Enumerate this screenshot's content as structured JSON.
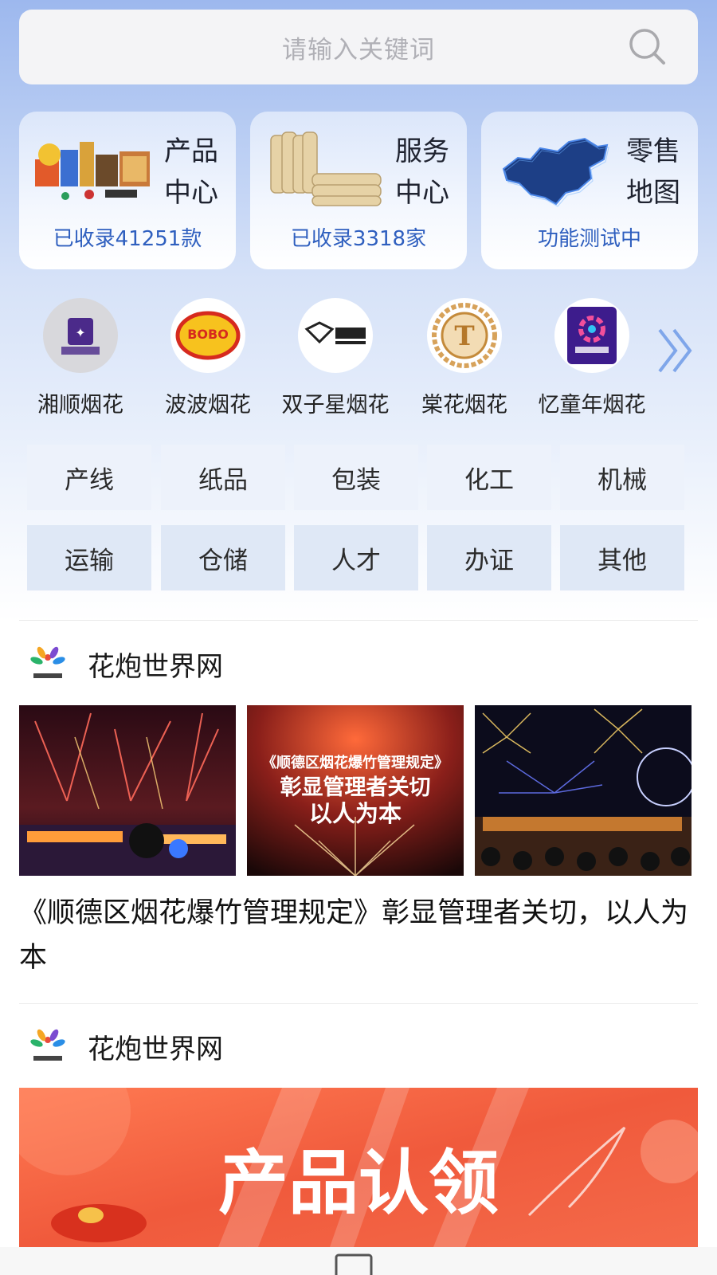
{
  "search": {
    "placeholder": "请输入关键词"
  },
  "cards": [
    {
      "title": "产品中心",
      "subtitle": "已收录41251款"
    },
    {
      "title": "服务中心",
      "subtitle": "已收录3318家"
    },
    {
      "title": "零售地图",
      "subtitle": "功能测试中"
    }
  ],
  "brands": [
    {
      "label": "湘顺烟花"
    },
    {
      "label": "波波烟花"
    },
    {
      "label": "双子星烟花"
    },
    {
      "label": "棠花烟花"
    },
    {
      "label": "忆童年烟花"
    }
  ],
  "categories": [
    "产线",
    "纸品",
    "包装",
    "化工",
    "机械",
    "运输",
    "仓储",
    "人才",
    "办证",
    "其他"
  ],
  "feed": [
    {
      "source": "花炮世界网",
      "image_overlay": [
        "《顺德区烟花爆竹管理规定》",
        "彰显管理者关切",
        "以人为本"
      ],
      "headline": "《顺德区烟花爆竹管理规定》彰显管理者关切，以人为本"
    },
    {
      "source": "花炮世界网",
      "banner_text": "产品认领"
    }
  ],
  "colors": {
    "accent": "#2f5fbf",
    "top_gradient": "#9db8ee",
    "banner": "#f05a3c"
  }
}
